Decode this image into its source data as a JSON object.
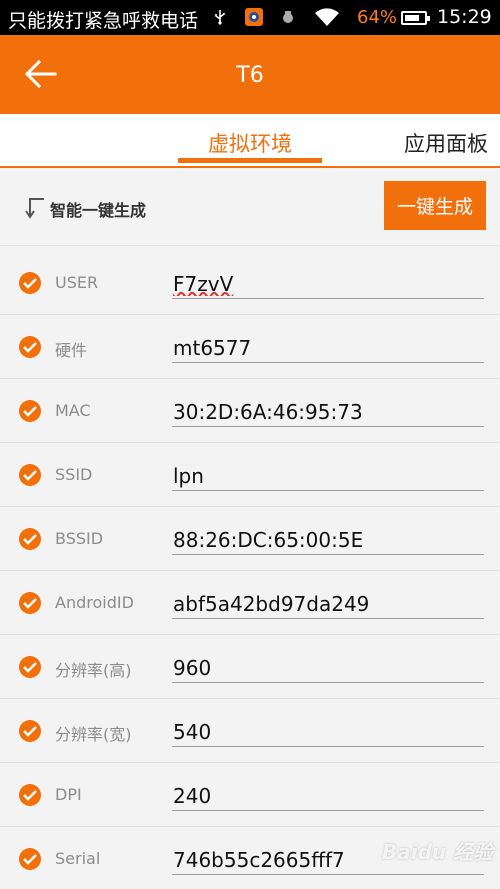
{
  "statusbar": {
    "carrier": "只能拨打紧急呼救电话",
    "battery_pct": "64%",
    "time": "15:29"
  },
  "header": {
    "title": "T6",
    "back_icon": "arrow-left-icon"
  },
  "tabs": [
    {
      "label": "虚拟环境",
      "active": true
    },
    {
      "label": "应用面板",
      "active": false
    }
  ],
  "generate": {
    "label": "智能一键生成",
    "button": "一键生成"
  },
  "fields": [
    {
      "label": "USER",
      "value": "F7zvV"
    },
    {
      "label": "硬件",
      "value": "mt6577"
    },
    {
      "label": "MAC",
      "value": "30:2D:6A:46:95:73"
    },
    {
      "label": "SSID",
      "value": "lpn"
    },
    {
      "label": "BSSID",
      "value": "88:26:DC:65:00:5E"
    },
    {
      "label": "AndroidID",
      "value": "abf5a42bd97da249"
    },
    {
      "label": "分辨率(高)",
      "value": "960"
    },
    {
      "label": "分辨率(宽)",
      "value": "540"
    },
    {
      "label": "DPI",
      "value": "240"
    },
    {
      "label": "Serial",
      "value": "746b55c2665fff7"
    }
  ],
  "watermark": "Baidu 经验",
  "colors": {
    "accent": "#f2700c",
    "status_bar": "#000000",
    "battery_text": "#ff7a1a"
  }
}
